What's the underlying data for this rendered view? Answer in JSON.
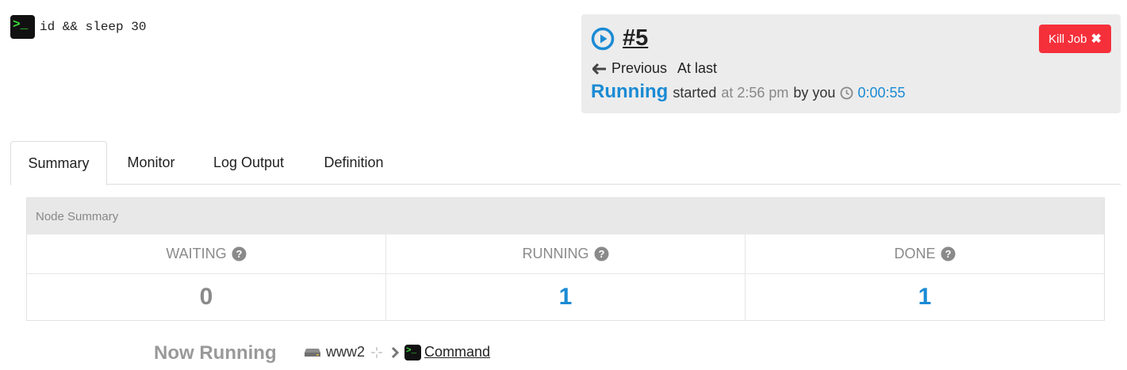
{
  "command": {
    "icon": "terminal-icon",
    "icon_text": ">_",
    "text": "id && sleep 30"
  },
  "job": {
    "number": "#5",
    "kill_label": "Kill Job",
    "kill_icon": "✖",
    "previous_label": "Previous",
    "at_last_label": "At last",
    "status": "Running",
    "started_label": "started",
    "started_at": "at 2:56 pm",
    "by": "by you",
    "duration": "0:00:55",
    "colors": {
      "accent": "#1b8bd4",
      "danger": "#f5303b"
    }
  },
  "tabs": [
    {
      "label": "Summary",
      "active": true
    },
    {
      "label": "Monitor"
    },
    {
      "label": "Log Output"
    },
    {
      "label": "Definition"
    }
  ],
  "node_summary": {
    "title": "Node Summary",
    "columns": [
      {
        "label": "WAITING",
        "value": "0"
      },
      {
        "label": "RUNNING",
        "value": "1"
      },
      {
        "label": "DONE",
        "value": "1"
      }
    ]
  },
  "now_running": {
    "label": "Now Running",
    "node": "www2",
    "step_icon_text": ">_",
    "step": "Command"
  }
}
